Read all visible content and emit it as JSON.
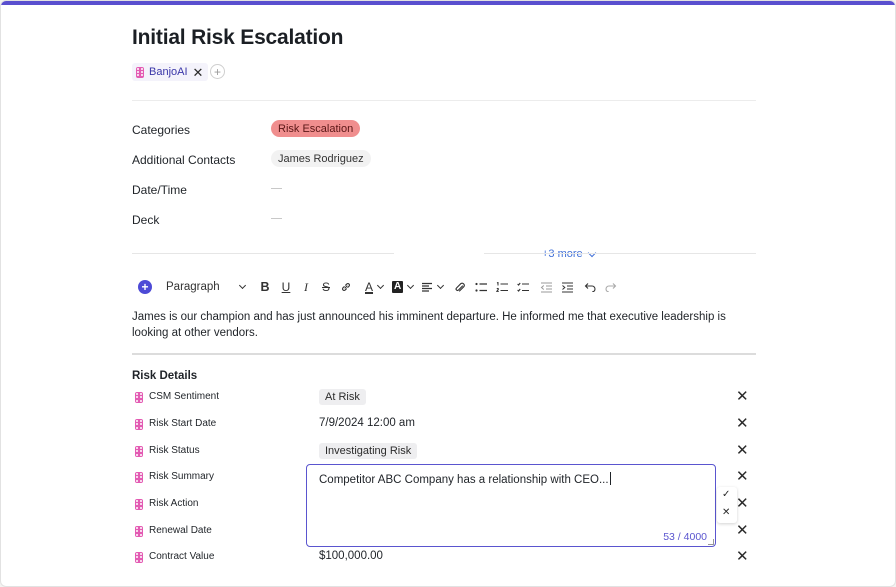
{
  "record": {
    "title": "Initial Risk Escalation",
    "tag_label": "BanjoAI",
    "tag_remove_glyph": "✕",
    "add_tag_glyph": "+"
  },
  "fields": {
    "categories_label": "Categories",
    "categories_value": "Risk Escalation",
    "contacts_label": "Additional Contacts",
    "contacts_value": "James Rodriguez",
    "datetime_label": "Date/Time",
    "deck_label": "Deck",
    "more_label": "+3 more"
  },
  "editor": {
    "add_block_glyph": "+",
    "paragraph_style": "Paragraph",
    "bold": "B",
    "underline": "U",
    "italic": "I",
    "strike": "S",
    "text_color": "A",
    "highlight": "A",
    "content": "James is our champion and has just announced his imminent departure. He informed me that executive leadership is looking at other vendors."
  },
  "risk_details": {
    "title": "Risk Details",
    "rows": [
      {
        "label": "CSM Sentiment",
        "value": "At Risk",
        "kind": "tag"
      },
      {
        "label": "Risk Start Date",
        "value": "7/9/2024 12:00 am",
        "kind": "text"
      },
      {
        "label": "Risk Status",
        "value": "Investigating Risk",
        "kind": "tag"
      },
      {
        "label": "Risk Summary",
        "value": "",
        "kind": "editing"
      },
      {
        "label": "Risk Action",
        "value": "",
        "kind": "empty"
      },
      {
        "label": "Renewal Date",
        "value": "",
        "kind": "empty"
      },
      {
        "label": "Contract Value",
        "value": "$100,000.00",
        "kind": "text"
      }
    ],
    "clear_glyph": "✕",
    "summary_input": {
      "value": "Competitor ABC Company has a relationship with CEO...",
      "counter": "53 / 4000"
    },
    "confirm_glyph": "✓",
    "cancel_glyph": "✕"
  },
  "colors": {
    "accent": "#5a4fcf",
    "risk_pill": "#f08e8e",
    "link": "#3f6fd8",
    "grip": "#e35bb3"
  }
}
